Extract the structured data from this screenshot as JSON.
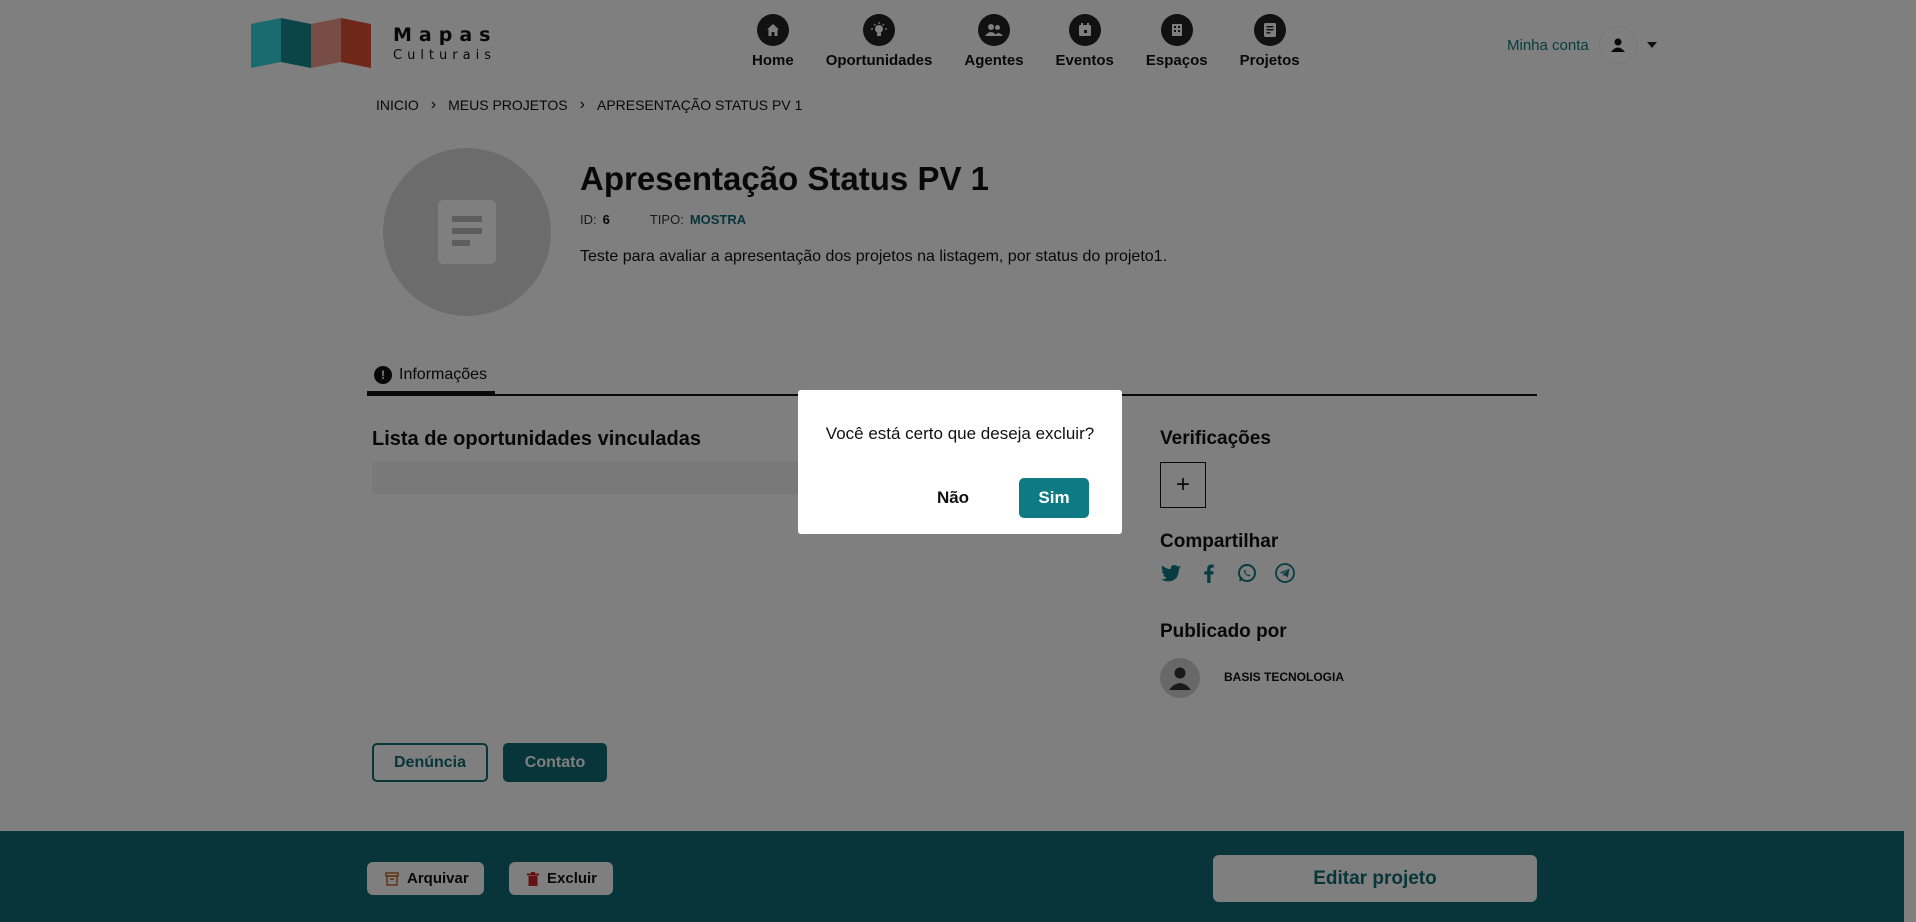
{
  "header": {
    "logo_title": "Mapas",
    "logo_subtitle": "Culturais",
    "nav": [
      {
        "label": "Home",
        "icon": "home-icon"
      },
      {
        "label": "Oportunidades",
        "icon": "lightbulb-icon"
      },
      {
        "label": "Agentes",
        "icon": "people-icon"
      },
      {
        "label": "Eventos",
        "icon": "calendar-icon"
      },
      {
        "label": "Espaços",
        "icon": "building-icon"
      },
      {
        "label": "Projetos",
        "icon": "project-icon"
      }
    ],
    "account_label": "Minha conta"
  },
  "breadcrumb": [
    "INICIO",
    "MEUS PROJETOS",
    "APRESENTAÇÃO STATUS PV 1"
  ],
  "project": {
    "title": "Apresentação Status PV 1",
    "id_label": "ID:",
    "id_value": "6",
    "type_label": "TIPO:",
    "type_value": "MOSTRA",
    "description": "Teste para avaliar a apresentação dos projetos na listagem, por status do projeto1."
  },
  "tabs": {
    "info_label": "Informações"
  },
  "main": {
    "opportunities_title": "Lista de oportunidades vinculadas"
  },
  "sidebar": {
    "verifications_title": "Verificações",
    "share_title": "Compartilhar",
    "published_by_title": "Publicado por",
    "publisher_name": "BASIS TECNOLOGIA"
  },
  "actions": {
    "denuncia_label": "Denúncia",
    "contato_label": "Contato"
  },
  "footer": {
    "arquivar_label": "Arquivar",
    "excluir_label": "Excluir",
    "editar_label": "Editar projeto"
  },
  "modal": {
    "message": "Você está certo que deseja excluir?",
    "no_label": "Não",
    "yes_label": "Sim"
  },
  "colors": {
    "brand_teal": "#0e6b75",
    "accent_teal": "#0e7a84",
    "overlay": "rgba(0,0,0,0.5)"
  }
}
